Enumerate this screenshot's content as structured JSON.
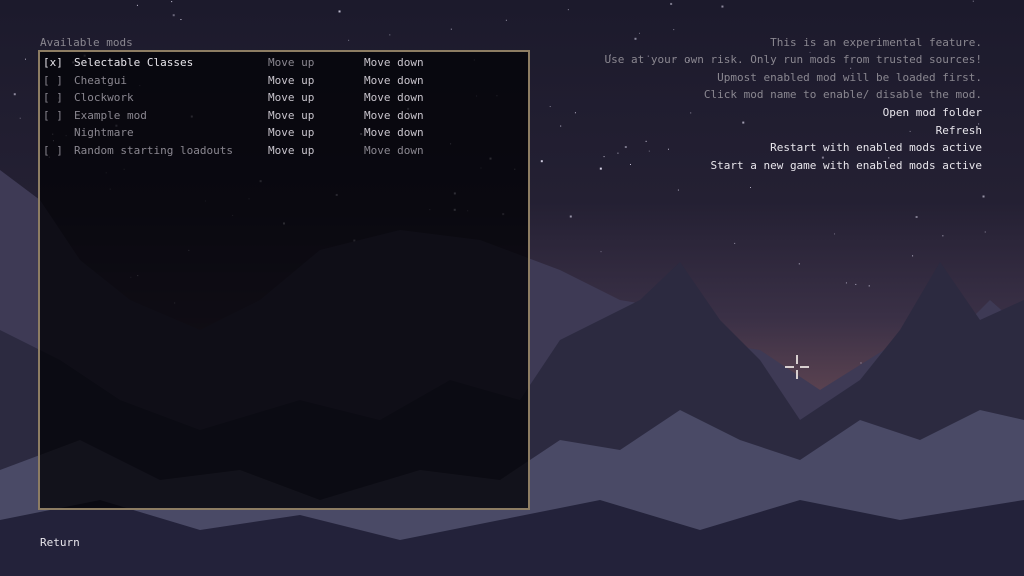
{
  "mods_header": "Available mods",
  "mods": [
    {
      "checkbox": "[x]",
      "name": "Selectable Classes",
      "enabled": true,
      "move_up": "Move up",
      "move_up_active": false,
      "move_down": "Move down",
      "move_down_active": true
    },
    {
      "checkbox": "[ ]",
      "name": "Cheatgui",
      "enabled": false,
      "move_up": "Move up",
      "move_up_active": true,
      "move_down": "Move down",
      "move_down_active": true
    },
    {
      "checkbox": "[ ]",
      "name": "Clockwork",
      "enabled": false,
      "move_up": "Move up",
      "move_up_active": true,
      "move_down": "Move down",
      "move_down_active": true
    },
    {
      "checkbox": "[ ]",
      "name": "Example mod",
      "enabled": false,
      "move_up": "Move up",
      "move_up_active": true,
      "move_down": "Move down",
      "move_down_active": true
    },
    {
      "checkbox": "",
      "name": "Nightmare",
      "enabled": false,
      "move_up": "Move up",
      "move_up_active": true,
      "move_down": "Move down",
      "move_down_active": true
    },
    {
      "checkbox": "[ ]",
      "name": "Random starting loadouts",
      "enabled": false,
      "move_up": "Move up",
      "move_up_active": true,
      "move_down": "Move down",
      "move_down_active": false
    }
  ],
  "info": [
    "This is an experimental feature.",
    "Use at your own risk. Only run mods from trusted sources!",
    "Upmost enabled mod will be loaded first.",
    "Click mod name to enable/ disable the mod."
  ],
  "actions": {
    "open_folder": "Open mod folder",
    "refresh": "Refresh",
    "restart": "Restart with enabled mods active",
    "new_game": "Start a new game with enabled mods active"
  },
  "return_label": "Return",
  "colors": {
    "panel_border": "#8d7d63",
    "text_active": "#e8e6ec",
    "text_inactive": "#8a8790"
  }
}
